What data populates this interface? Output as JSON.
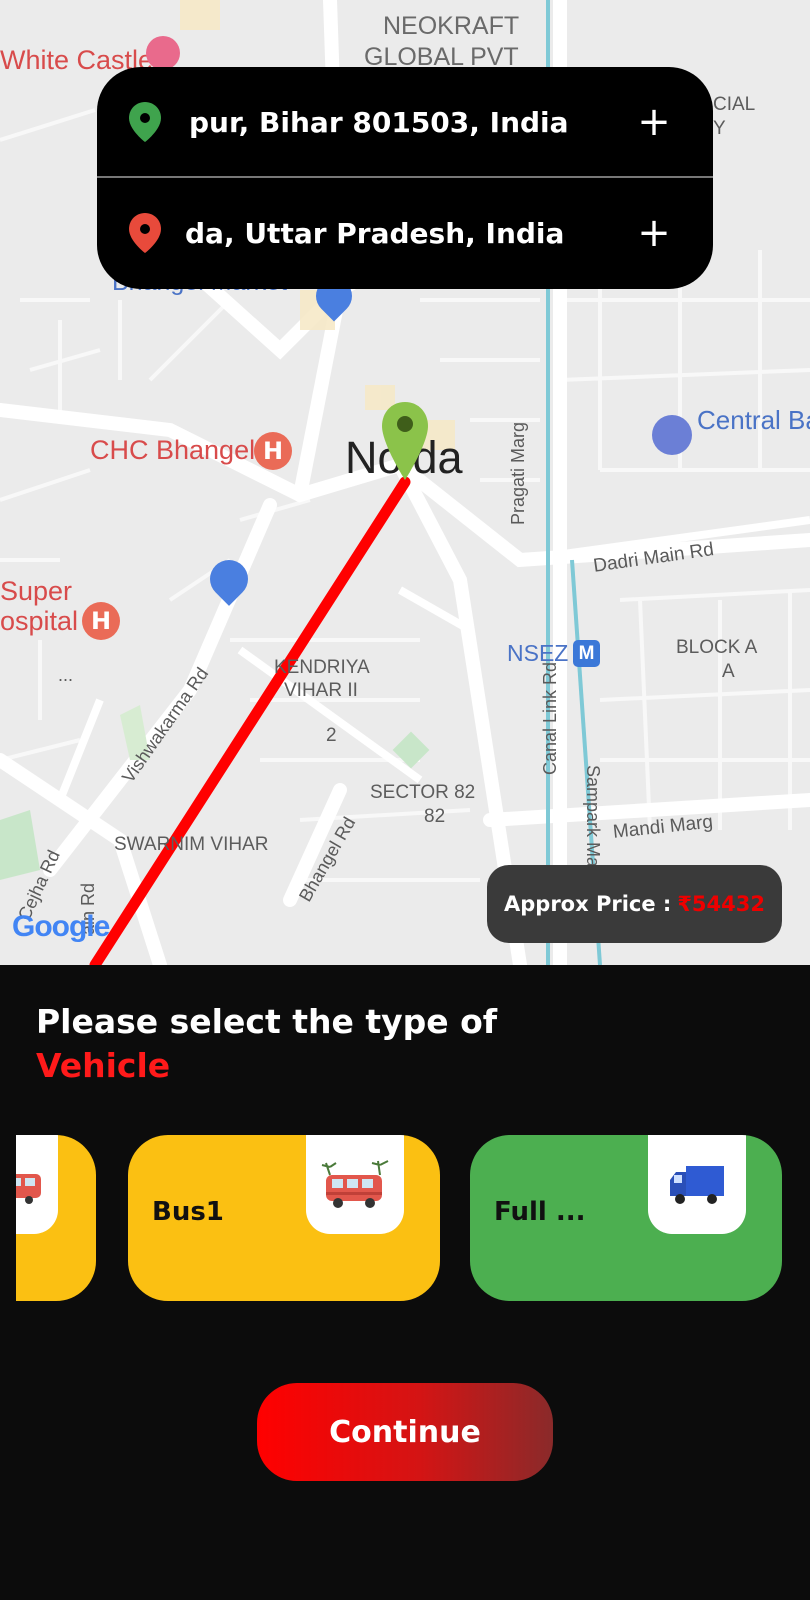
{
  "route": {
    "origin": "pur, Bihar 801503, India",
    "destination": "da, Uttar Pradesh, India",
    "origin_icon": "green-location-pin-icon",
    "destination_icon": "red-location-pin-icon",
    "add_icon": "plus-icon"
  },
  "map": {
    "labels": {
      "white_castle": "White Castle",
      "neokraft_1": "NEOKRAFT",
      "neokraft_2": "GLOBAL PVT",
      "cial_1": "CIAL",
      "cial_2": "Y",
      "bhangel_market": "Bhangel Market",
      "chc_bhangel": "CHC Bhangel",
      "noida": "Noida",
      "central_bank": "Central Ba",
      "pragati_marg": "Pragati Marg",
      "dadri_main_rd": "Dadri Main Rd",
      "super_1": "Super",
      "super_2": "ospital",
      "super_3": "...",
      "nsez": "NSEZ",
      "metro": "M",
      "block_a_1": "BLOCK A",
      "block_a_2": "A",
      "kendriya_1": "KENDRIYA",
      "kendriya_2": "VIHAR II",
      "kendriya_3": "2",
      "vishwakarma_rd": "Vishwakarma Rd",
      "canal_link_rd": "Canal Link Rd",
      "sampark_marg": "Sampark Marg",
      "sector82_1": "SECTOR 82",
      "sector82_2": "82",
      "mandi_marg": "Mandi Marg",
      "swarnim_vihar": "SWARNIM VIHAR",
      "bhangel_rd": "Bhangel Rd",
      "cejha_rd": "Cejha Rd",
      "ain_rd": "ain Rd",
      "google": "Google"
    },
    "route_color": "#ff0000"
  },
  "price": {
    "label": "Approx Price :",
    "value": "₹54432"
  },
  "sheet": {
    "title": "Please select the type of",
    "title_highlight": "Vehicle"
  },
  "vehicles": [
    {
      "name": "",
      "icon": "bus-icon",
      "color": "#fbc012"
    },
    {
      "name": "Bus1",
      "icon": "bus-icon",
      "color": "#fbc012"
    },
    {
      "name": "Full ...",
      "icon": "truck-icon",
      "color": "#4caf50"
    }
  ],
  "continue_label": "Continue",
  "colors": {
    "accent": "#ff0000",
    "background": "#0c0c0c"
  }
}
